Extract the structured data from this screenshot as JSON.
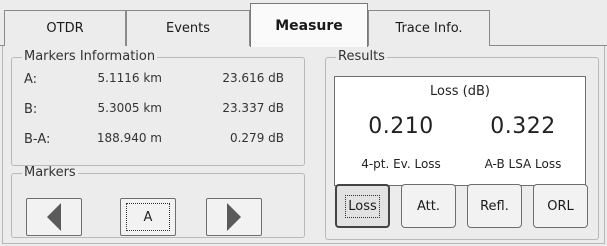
{
  "tabs": [
    {
      "label": "OTDR"
    },
    {
      "label": "Events"
    },
    {
      "label": "Measure"
    },
    {
      "label": "Trace Info."
    }
  ],
  "active_tab": "Measure",
  "markers_info": {
    "legend": "Markers Information",
    "rows": [
      {
        "label": "A:",
        "distance": "5.1116 km",
        "level": "23.616 dB"
      },
      {
        "label": "B:",
        "distance": "5.3005 km",
        "level": "23.337 dB"
      },
      {
        "label": "B-A:",
        "distance": "188.940 m",
        "level": "0.279 dB"
      }
    ]
  },
  "markers": {
    "legend": "Markers",
    "selected": "A",
    "prev_icon": "left-triangle",
    "next_icon": "right-triangle"
  },
  "results": {
    "legend": "Results",
    "title": "Loss (dB)",
    "left": {
      "value": "0.210",
      "caption": "4-pt. Ev. Loss"
    },
    "right": {
      "value": "0.322",
      "caption": "A-B LSA Loss"
    },
    "buttons": [
      {
        "label": "Loss"
      },
      {
        "label": "Att."
      },
      {
        "label": "Refl."
      },
      {
        "label": "ORL"
      }
    ],
    "selected_button": "Loss"
  }
}
